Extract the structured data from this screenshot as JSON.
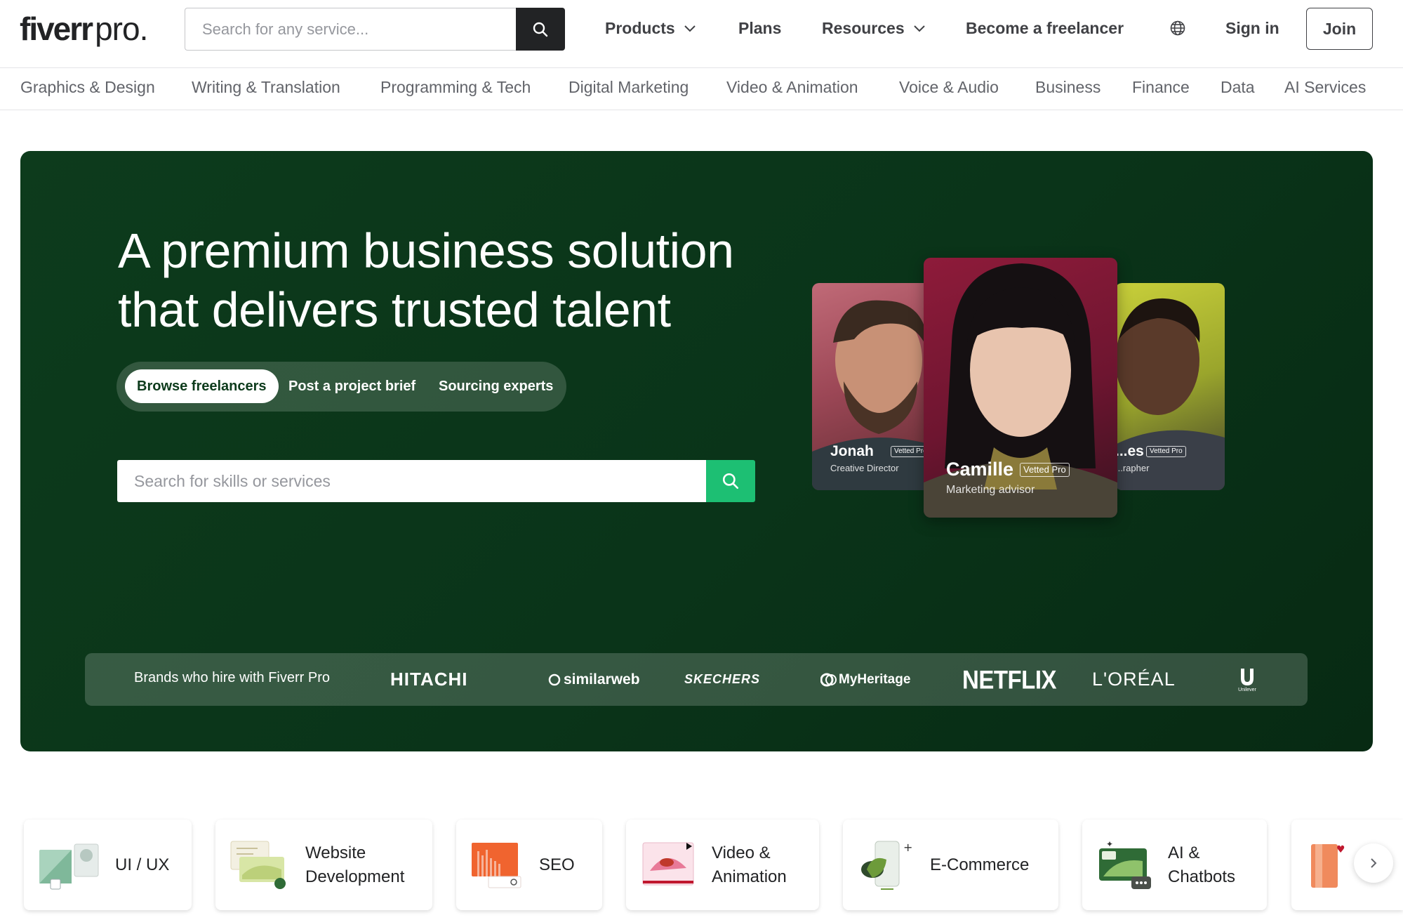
{
  "header": {
    "logo_main": "fiverr",
    "logo_pro": "pro.",
    "search_placeholder": "Search for any service...",
    "nav": {
      "products": "Products",
      "plans": "Plans",
      "resources": "Resources",
      "become_freelancer": "Become a freelancer",
      "sign_in": "Sign in",
      "join": "Join"
    }
  },
  "categories": [
    "Graphics & Design",
    "Writing & Translation",
    "Programming & Tech",
    "Digital Marketing",
    "Video & Animation",
    "Voice & Audio",
    "Business",
    "Finance",
    "Data",
    "AI Services"
  ],
  "hero": {
    "title_line1": "A premium business solution",
    "title_line2": "that delivers trusted talent",
    "tabs": [
      "Browse freelancers",
      "Post a project brief",
      "Sourcing experts"
    ],
    "active_tab": "Browse freelancers",
    "search_placeholder": "Search for skills or services",
    "freelancers": [
      {
        "name": "Jonah",
        "role": "Creative Director",
        "badge": "Vetted Pro"
      },
      {
        "name": "Camille",
        "role": "Marketing advisor",
        "badge": "Vetted Pro"
      },
      {
        "name": "...es",
        "role": "...rapher",
        "badge": "Vetted Pro"
      }
    ],
    "brands_label": "Brands who hire with Fiverr Pro",
    "brands": [
      "HITACHI",
      "similarweb",
      "SKECHERS",
      "MyHeritage",
      "NETFLIX",
      "L'ORÉAL",
      "Unilever"
    ]
  },
  "services": [
    {
      "line1": "UI / UX",
      "line2": ""
    },
    {
      "line1": "Website",
      "line2": "Development"
    },
    {
      "line1": "SEO",
      "line2": ""
    },
    {
      "line1": "Video &",
      "line2": "Animation"
    },
    {
      "line1": "E-Commerce",
      "line2": ""
    },
    {
      "line1": "AI &",
      "line2": "Chatbots"
    }
  ],
  "colors": {
    "hero_bg": "#0d3b1c",
    "accent_green": "#1dbf73",
    "text_dark": "#222325"
  },
  "icons": [
    "search-icon",
    "chevron-down-icon",
    "globe-icon",
    "chevron-right-icon"
  ]
}
